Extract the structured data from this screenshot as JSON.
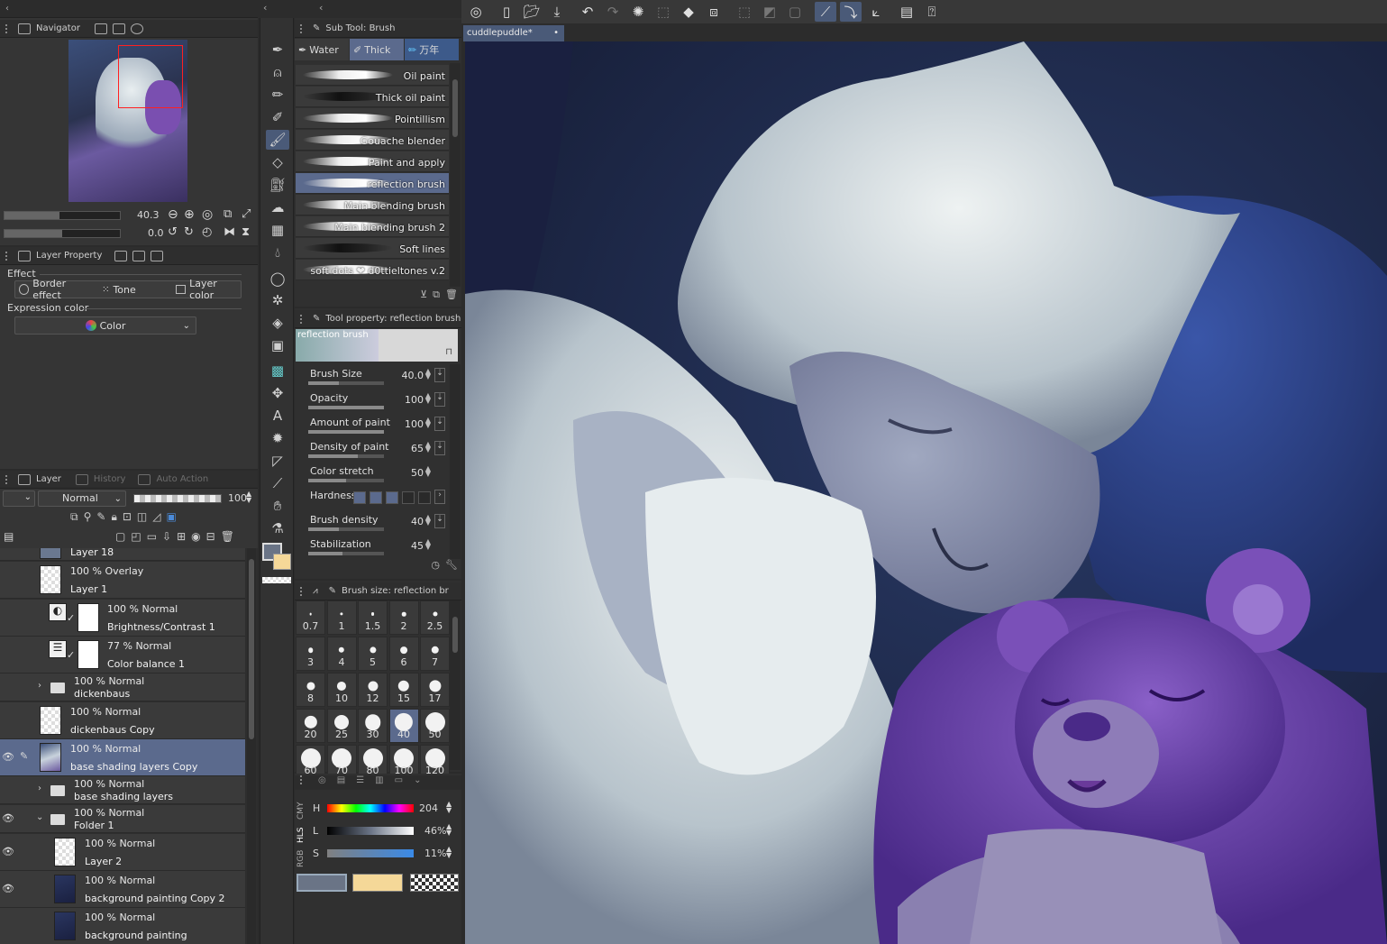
{
  "navigator": {
    "title": "Navigator",
    "zoom": "40.3",
    "rotation": "0.0"
  },
  "layer_property": {
    "title": "Layer Property",
    "effect_label": "Effect",
    "border_effect": "Border effect",
    "tone": "Tone",
    "layer_color": "Layer color",
    "expression_color_label": "Expression color",
    "expression_color_value": "Color"
  },
  "layer_panel": {
    "tabs": [
      "Layer",
      "History",
      "Auto Action"
    ],
    "blend_mode": "Normal",
    "opacity": "100",
    "layers": [
      {
        "mode": "",
        "name": "Layer 18"
      },
      {
        "mode": "100 % Overlay",
        "name": "Layer 1"
      },
      {
        "mode": "100 % Normal",
        "name": "Brightness/Contrast 1"
      },
      {
        "mode": "77 % Normal",
        "name": "Color balance 1"
      },
      {
        "mode": "100 % Normal",
        "name": "dickenbaus"
      },
      {
        "mode": "100 % Normal",
        "name": "dickenbaus Copy"
      },
      {
        "mode": "100 % Normal",
        "name": "base shading layers Copy"
      },
      {
        "mode": "100 % Normal",
        "name": "base shading layers"
      },
      {
        "mode": "100 % Normal",
        "name": "Folder 1"
      },
      {
        "mode": "100 % Normal",
        "name": "Layer 2"
      },
      {
        "mode": "100 % Normal",
        "name": "background painting Copy 2"
      },
      {
        "mode": "100 % Normal",
        "name": "background painting"
      }
    ]
  },
  "sub_tool": {
    "title": "Sub Tool: Brush",
    "tabs": [
      "Water",
      "Thick",
      "万年"
    ],
    "brushes": [
      "Oil paint",
      "Thick oil paint",
      "Pointillism",
      "Gouache blender",
      "Paint and apply",
      "reflection brush",
      "Main blending brush",
      "Main blending brush 2",
      "Soft lines",
      "soft dots ❤ d0ttieltones v.2"
    ],
    "selected": "reflection brush"
  },
  "tool_property": {
    "title": "Tool property: reflection brush",
    "preview_label": "reflection brush",
    "props": [
      {
        "label": "Brush Size",
        "value": "40.0",
        "fill": 0.4
      },
      {
        "label": "Opacity",
        "value": "100",
        "fill": 1.0
      },
      {
        "label": "Amount of paint",
        "value": "100",
        "fill": 1.0
      },
      {
        "label": "Density of paint",
        "value": "65",
        "fill": 0.65
      },
      {
        "label": "Color stretch",
        "value": "50",
        "fill": 0.5
      },
      {
        "label": "Hardness",
        "value": "",
        "fill": 0
      },
      {
        "label": "Brush density",
        "value": "40",
        "fill": 0.4
      },
      {
        "label": "Stabilization",
        "value": "45",
        "fill": 0.45
      }
    ]
  },
  "brush_size": {
    "title": "Brush size: reflection br",
    "sizes": [
      "0.7",
      "1",
      "1.5",
      "2",
      "2.5",
      "3",
      "4",
      "5",
      "6",
      "7",
      "8",
      "10",
      "12",
      "15",
      "17",
      "20",
      "25",
      "30",
      "40",
      "50",
      "60",
      "70",
      "80",
      "100",
      "120"
    ],
    "selected": "40"
  },
  "color": {
    "modes": [
      "RGB",
      "HLS",
      "CMY"
    ],
    "h_label": "H",
    "h_value": "204",
    "l_label": "L",
    "l_value": "46%",
    "s_label": "S",
    "s_value": "11%",
    "main_color": "#6a7486",
    "sub_color": "#f5d898"
  },
  "canvas": {
    "tab_name": "cuddlepuddle*"
  }
}
